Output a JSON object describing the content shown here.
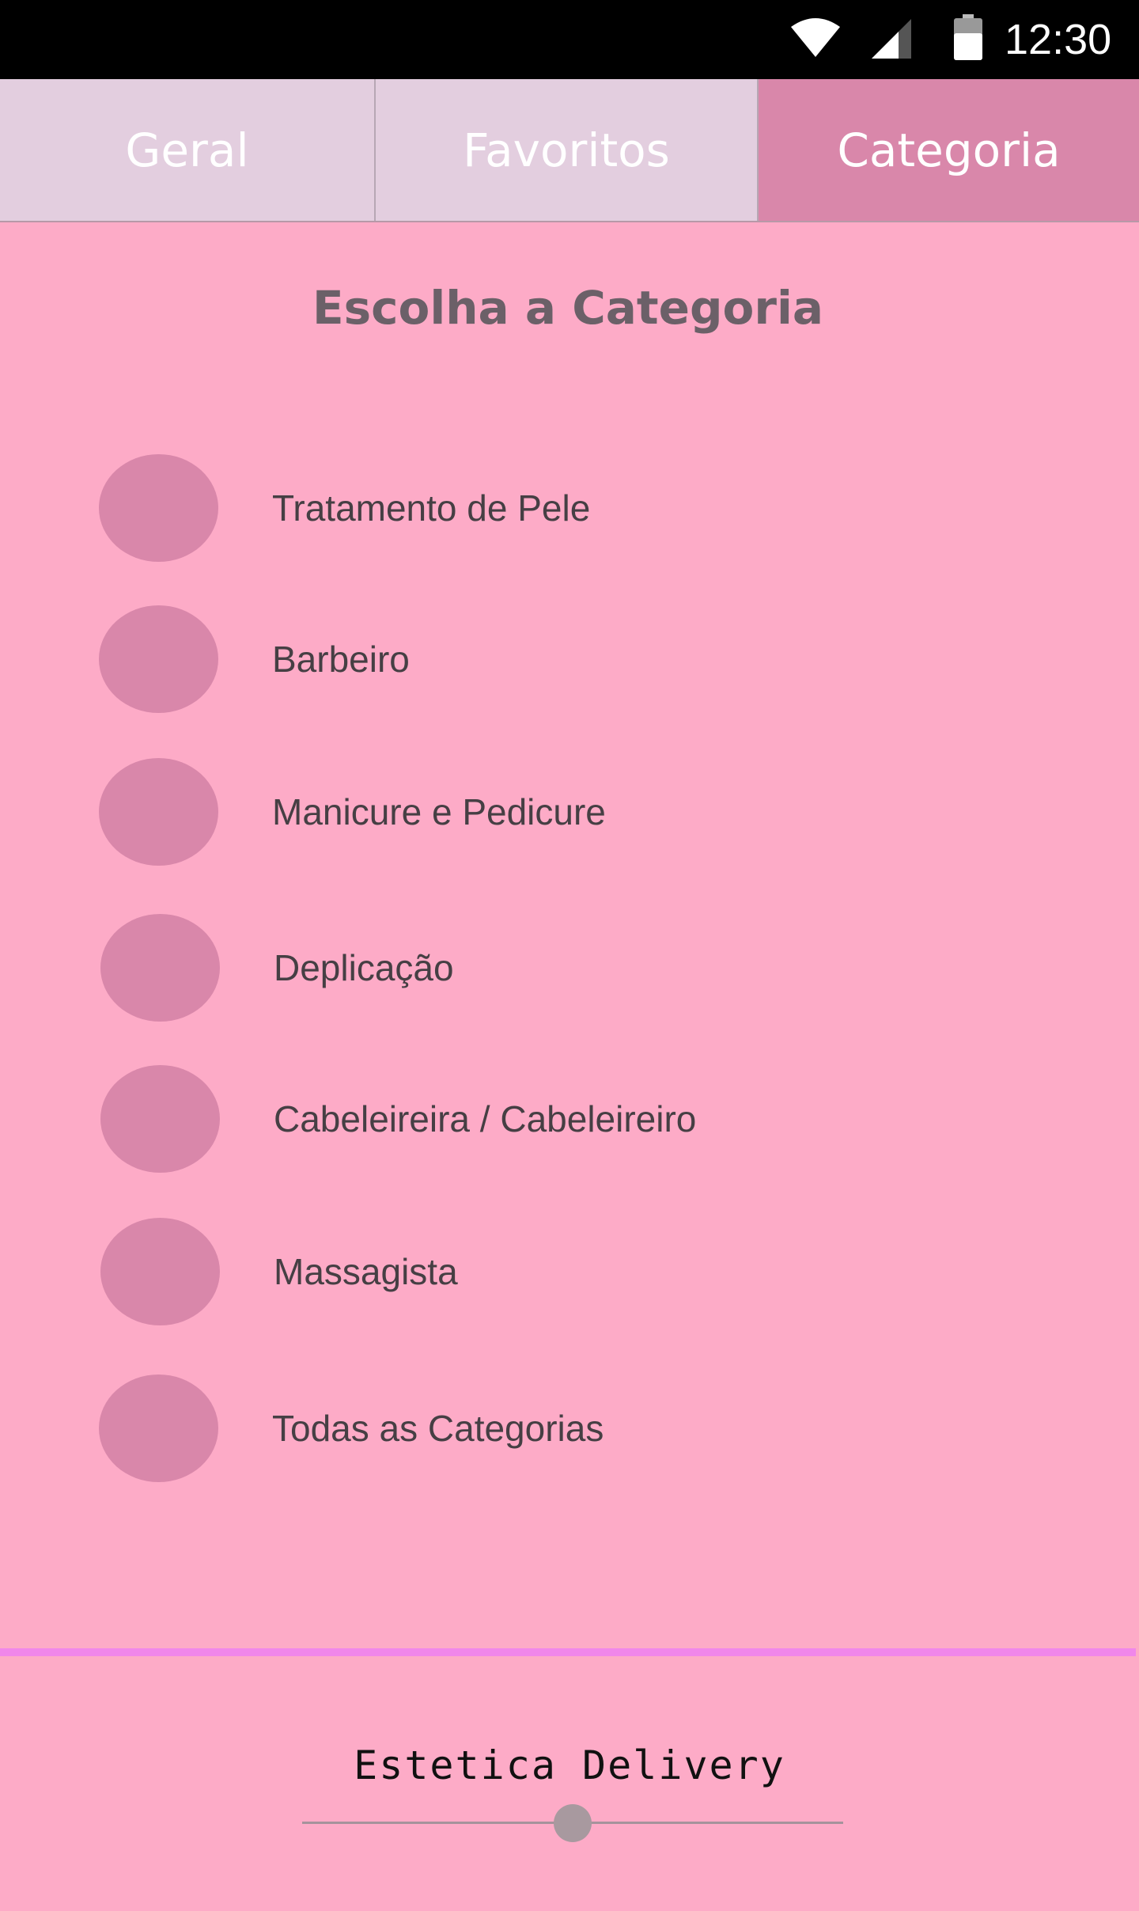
{
  "status_bar": {
    "time": "12:30",
    "icons": [
      "wifi-icon",
      "cell-signal-icon",
      "battery-icon"
    ]
  },
  "tabs": [
    {
      "label": "Geral",
      "active": false
    },
    {
      "label": "Favoritos",
      "active": false
    },
    {
      "label": "Categoria",
      "active": true
    }
  ],
  "page": {
    "title": "Escolha a Categoria"
  },
  "categories": [
    {
      "label": "Tratamento de Pele"
    },
    {
      "label": "Barbeiro"
    },
    {
      "label": "Manicure e Pedicure"
    },
    {
      "label": "Deplicação"
    },
    {
      "label": "Cabeleireira / Cabeleireiro"
    },
    {
      "label": "Massagista"
    },
    {
      "label": "Todas as Categorias"
    }
  ],
  "footer": {
    "brand": "Estetica Delivery",
    "slider_value": 0.5
  },
  "colors": {
    "background": "#fdabc7",
    "tab_inactive": "#e3cedf",
    "tab_active": "#d987aa",
    "radio_fill": "#d987aa",
    "divider": "#f087ea",
    "title_text": "#6b6068",
    "label_text": "#463f44"
  }
}
